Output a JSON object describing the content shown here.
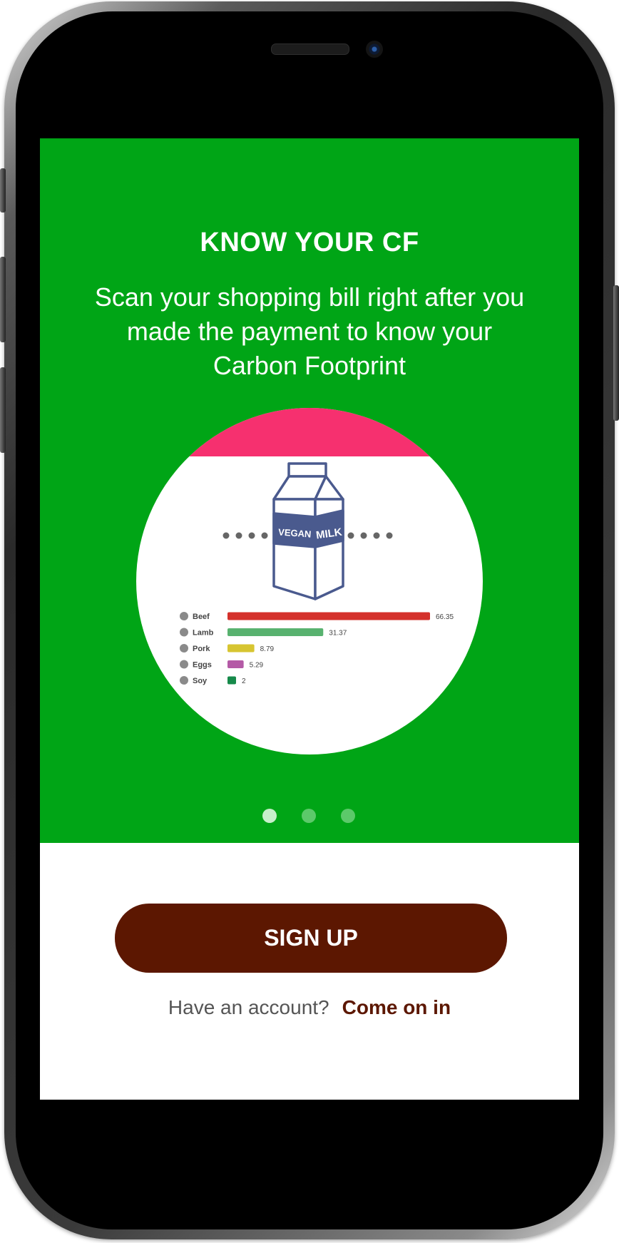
{
  "onboarding": {
    "title": "KNOW YOUR CF",
    "subtitle": "Scan your shopping bill right after you made the payment to know your Carbon Footprint",
    "carton_text": [
      "VEGAN",
      "MILK"
    ],
    "slide_count": 3,
    "active_slide": 0
  },
  "chart_data": {
    "type": "bar",
    "orientation": "horizontal",
    "categories": [
      "Beef",
      "Lamb",
      "Pork",
      "Eggs",
      "Soy"
    ],
    "values": [
      66.35,
      31.37,
      8.79,
      5.29,
      2
    ],
    "value_labels": [
      "66.35",
      "31.37",
      "8.79",
      "5.29",
      "2"
    ],
    "colors": [
      "#d4312b",
      "#58b26f",
      "#d7c531",
      "#b45aa6",
      "#168a4a"
    ],
    "icons": [
      "cow-icon",
      "sheep-icon",
      "pig-icon",
      "eggs-icon",
      "soy-icon"
    ]
  },
  "actions": {
    "signup_label": "SIGN UP",
    "have_account": "Have an account?",
    "login_link": "Come on in"
  },
  "colors": {
    "hero_bg": "#00a516",
    "accent_pink": "#f6306f",
    "carton_blue": "#4a5a8e",
    "button_bg": "#5c1701",
    "link": "#5c1701"
  }
}
